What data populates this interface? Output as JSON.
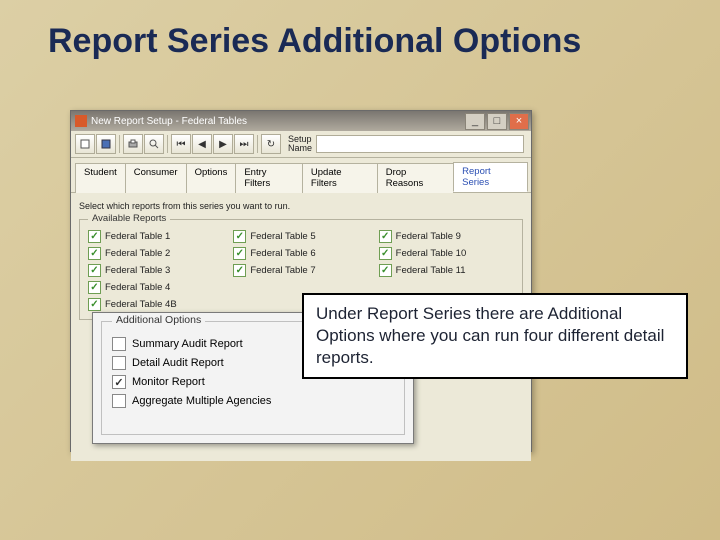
{
  "slide_title": "Report Series Additional Options",
  "window": {
    "title": "New Report Setup - Federal Tables",
    "min_btn": "_",
    "max_btn": "□",
    "close_btn": "×",
    "setup_label_line1": "Setup",
    "setup_label_line2": "Name",
    "setup_value": ""
  },
  "tabs": {
    "items": [
      {
        "label": "Student"
      },
      {
        "label": "Consumer"
      },
      {
        "label": "Options"
      },
      {
        "label": "Entry Filters"
      },
      {
        "label": "Update Filters"
      },
      {
        "label": "Drop Reasons"
      },
      {
        "label": "Report Series"
      }
    ],
    "active_index": 6
  },
  "panel": {
    "instructions": "Select which reports from this series you want to run.",
    "available_label": "Available Reports",
    "reports": [
      {
        "label": "Federal Table 1",
        "checked": true
      },
      {
        "label": "Federal Table 5",
        "checked": true
      },
      {
        "label": "Federal Table 9",
        "checked": true
      },
      {
        "label": "Federal Table 2",
        "checked": true
      },
      {
        "label": "Federal Table 6",
        "checked": true
      },
      {
        "label": "Federal Table 10",
        "checked": true
      },
      {
        "label": "Federal Table 3",
        "checked": true
      },
      {
        "label": "Federal Table 7",
        "checked": true
      },
      {
        "label": "Federal Table 11",
        "checked": true
      },
      {
        "label": "Federal Table 4",
        "checked": true
      },
      {
        "label": "",
        "checked": false
      },
      {
        "label": "",
        "checked": false
      },
      {
        "label": "Federal Table 4B",
        "checked": true
      }
    ]
  },
  "overlay": {
    "legend": "Additional Options",
    "options": [
      {
        "label": "Summary Audit Report",
        "checked": false
      },
      {
        "label": "Detail Audit Report",
        "checked": false
      },
      {
        "label": "Monitor Report",
        "checked": true
      },
      {
        "label": "Aggregate Multiple Agencies",
        "checked": false
      }
    ]
  },
  "callout": "Under Report Series there are Additional Options where you can run four different detail reports."
}
